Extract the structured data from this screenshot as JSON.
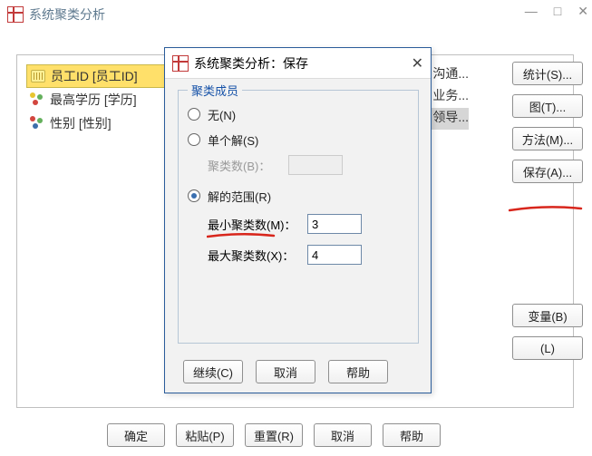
{
  "window": {
    "title": "系统聚类分析",
    "controls": {
      "min": "—",
      "max": "□",
      "close": "✕"
    }
  },
  "variables": {
    "items": [
      {
        "label": "员工ID [员工ID]"
      },
      {
        "label": "最高学历 [学历]"
      },
      {
        "label": "性别 [性别]"
      }
    ]
  },
  "bg_items": [
    "沟通...",
    "业务...",
    "领导..."
  ],
  "right_buttons": {
    "stat": "统计(S)...",
    "plot": "图(T)...",
    "method": "方法(M)...",
    "save": "保存(A)..."
  },
  "right_buttons2": {
    "var_b": "变量(B)",
    "l": "(L)"
  },
  "bottom_buttons": {
    "ok": "确定",
    "paste": "粘贴(P)",
    "reset": "重置(R)",
    "cancel": "取消",
    "help": "帮助"
  },
  "modal": {
    "title": "系统聚类分析：保存",
    "close": "✕",
    "fieldset_legend": "聚类成员",
    "radios": {
      "none": "无(N)",
      "single": "单个解(S)",
      "count_label": "聚类数(B)：",
      "range": "解的范围(R)",
      "min_label": "最小聚类数(M)：",
      "max_label": "最大聚类数(X)："
    },
    "values": {
      "min": "3",
      "max": "4"
    },
    "buttons": {
      "cont": "继续(C)",
      "cancel": "取消",
      "help": "帮助"
    }
  }
}
